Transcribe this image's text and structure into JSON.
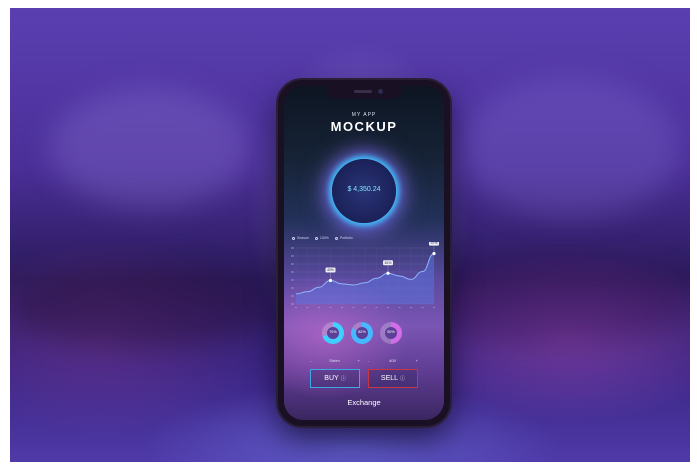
{
  "app": {
    "subtitle": "MY APP",
    "title": "MOCKUP"
  },
  "balance": {
    "value": "$ 4,350.24"
  },
  "legend": {
    "items": [
      "Season",
      "100%",
      "Portfolio"
    ]
  },
  "chart_data": {
    "type": "line",
    "y_tick_count": 8,
    "x_tick_count": 13,
    "series": [
      {
        "values": [
          0.18,
          0.22,
          0.3,
          0.42,
          0.36,
          0.34,
          0.38,
          0.46,
          0.55,
          0.5,
          0.44,
          0.58,
          0.9
        ]
      }
    ],
    "markers": [
      {
        "index": 3,
        "label": "40%"
      },
      {
        "index": 8,
        "label": "61%"
      },
      {
        "index": 12,
        "label": "97%"
      }
    ],
    "grid": true,
    "colors": {
      "line": "#8fb4ff",
      "fill": "#5a78e6",
      "grid": "#7c89b2"
    }
  },
  "donuts": [
    {
      "label": "70%",
      "fraction": 0.7,
      "color": "#3fd0ff"
    },
    {
      "label": "82%",
      "fraction": 0.82,
      "color": "#45b8ff"
    },
    {
      "label": "50%",
      "fraction": 0.5,
      "color": "#d36ce8"
    }
  ],
  "steppers": [
    {
      "minus": "-",
      "value": "Shrim",
      "plus": "+"
    },
    {
      "minus": "-",
      "value": "400",
      "plus": "+"
    }
  ],
  "actions": {
    "buy_label": "BUY",
    "sell_label": "SELL",
    "footer_label": "Exchange"
  },
  "colors": {
    "buy_border": "#3fa7e6",
    "sell_border": "#c8373f",
    "glow": "#7fe3ff"
  }
}
